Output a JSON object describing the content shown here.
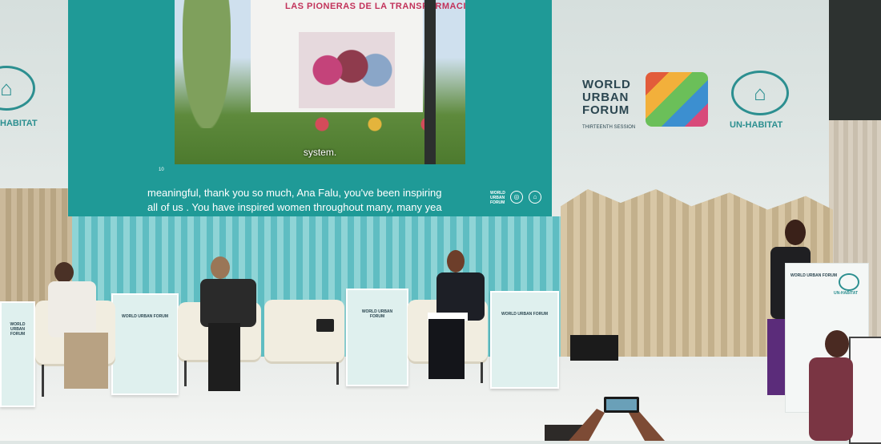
{
  "screen": {
    "photo_sign": "LAS PIONERAS DE LA TRANSFORMACIÓN",
    "photo_subtitle": "system.",
    "slide_number": "10",
    "caption_line1": "meaningful, thank you so much,  Ana Falu, you've been inspiring",
    "caption_line2": "all of us . You have inspired women throughout many, many yea",
    "mini_logo": "WORLD URBAN FORUM"
  },
  "wall": {
    "left_un_label": "HABITAT",
    "wuf_line1": "WORLD",
    "wuf_line2": "URBAN",
    "wuf_line3": "FORUM",
    "wuf_edition": "THIRTEENTH SESSION",
    "right_un_label": "UN-HABITAT"
  },
  "pod_logo": "WORLD URBAN FORUM",
  "lectern_logo": "WORLD URBAN FORUM",
  "lectern_un": "UN-HABITAT",
  "colors": {
    "screen_teal": "#1f9a97",
    "un_blue": "#2c8f90",
    "slat_teal": "#5fbdc2"
  }
}
